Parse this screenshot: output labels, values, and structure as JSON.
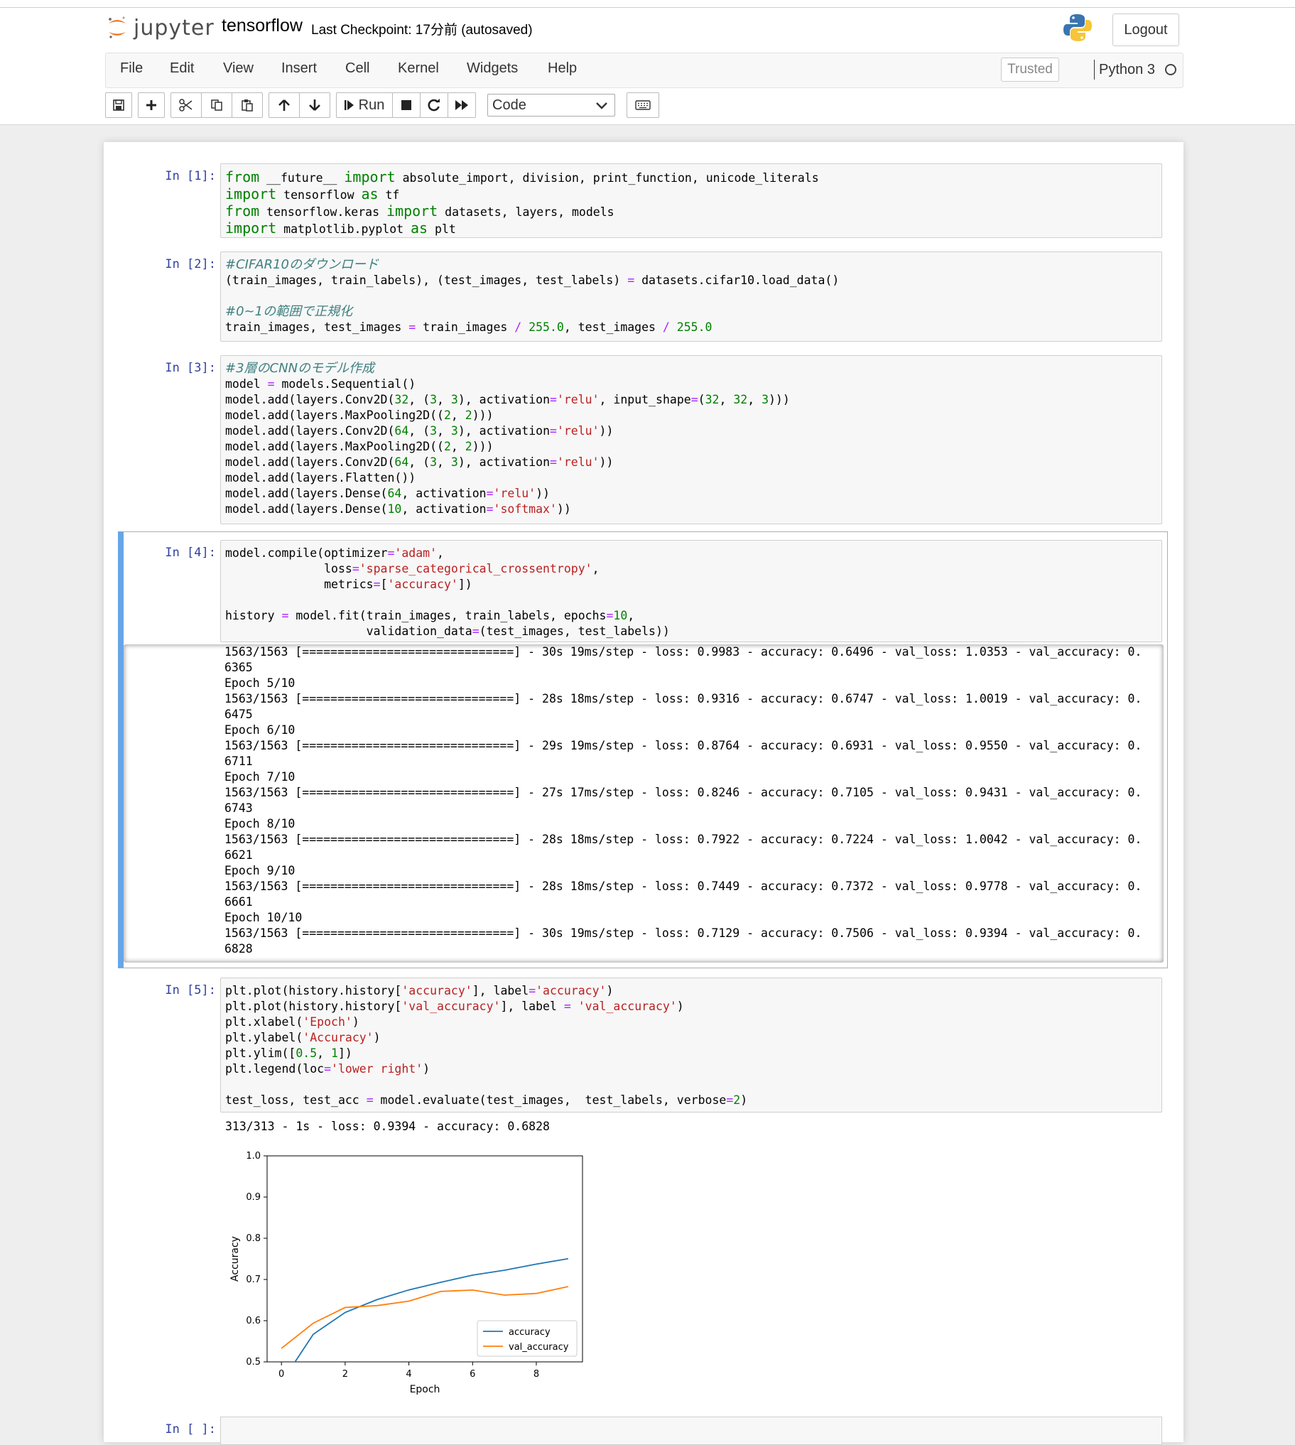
{
  "header": {
    "logo_text": "jupyter",
    "notebook_name": "tensorflow",
    "checkpoint_text": "Last Checkpoint: 17分前  (autosaved)",
    "logout_label": "Logout"
  },
  "menu": {
    "items": [
      "File",
      "Edit",
      "View",
      "Insert",
      "Cell",
      "Kernel",
      "Widgets",
      "Help"
    ],
    "trusted_label": "Trusted",
    "kernel_name": "Python 3"
  },
  "toolbar": {
    "run_label": "Run",
    "cell_type": "Code"
  },
  "cells": [
    {
      "prompt": "In [1]:"
    },
    {
      "prompt": "In [2]:"
    },
    {
      "prompt": "In [3]:"
    },
    {
      "prompt": "In [4]:"
    },
    {
      "prompt": "In [5]:"
    },
    {
      "prompt": "In [ ]:"
    }
  ],
  "cell4_output": [
    "1563/1563 [==============================] - 30s 19ms/step - loss: 0.9983 - accuracy: 0.6496 - val_loss: 1.0353 - val_accuracy: 0.",
    "6365",
    "Epoch 5/10",
    "1563/1563 [==============================] - 28s 18ms/step - loss: 0.9316 - accuracy: 0.6747 - val_loss: 1.0019 - val_accuracy: 0.",
    "6475",
    "Epoch 6/10",
    "1563/1563 [==============================] - 29s 19ms/step - loss: 0.8764 - accuracy: 0.6931 - val_loss: 0.9550 - val_accuracy: 0.",
    "6711",
    "Epoch 7/10",
    "1563/1563 [==============================] - 27s 17ms/step - loss: 0.8246 - accuracy: 0.7105 - val_loss: 0.9431 - val_accuracy: 0.",
    "6743",
    "Epoch 8/10",
    "1563/1563 [==============================] - 28s 18ms/step - loss: 0.7922 - accuracy: 0.7224 - val_loss: 1.0042 - val_accuracy: 0.",
    "6621",
    "Epoch 9/10",
    "1563/1563 [==============================] - 28s 18ms/step - loss: 0.7449 - accuracy: 0.7372 - val_loss: 0.9778 - val_accuracy: 0.",
    "6661",
    "Epoch 10/10",
    "1563/1563 [==============================] - 30s 19ms/step - loss: 0.7129 - accuracy: 0.7506 - val_loss: 0.9394 - val_accuracy: 0.",
    "6828"
  ],
  "cell5_eval_output": "313/313 - 1s - loss: 0.9394 - accuracy: 0.6828",
  "chart_data": {
    "type": "line",
    "xlabel": "Epoch",
    "ylabel": "Accuracy",
    "ylim": [
      0.5,
      1.0
    ],
    "xlim": [
      -0.45,
      9.45
    ],
    "xticks": [
      0,
      2,
      4,
      6,
      8
    ],
    "yticks": [
      0.5,
      0.6,
      0.7,
      0.8,
      0.9,
      1.0
    ],
    "legend_loc": "lower right",
    "grid": false,
    "x": [
      0,
      1,
      2,
      3,
      4,
      5,
      6,
      7,
      8,
      9
    ],
    "series": [
      {
        "name": "accuracy",
        "color": "#1f77b4",
        "values": [
          0.45,
          0.567,
          0.62,
          0.651,
          0.6747,
          0.6931,
          0.7105,
          0.7224,
          0.7372,
          0.7506
        ]
      },
      {
        "name": "val_accuracy",
        "color": "#ff7f0e",
        "values": [
          0.533,
          0.594,
          0.632,
          0.6365,
          0.6475,
          0.6711,
          0.6743,
          0.6621,
          0.6661,
          0.6828
        ]
      }
    ]
  }
}
